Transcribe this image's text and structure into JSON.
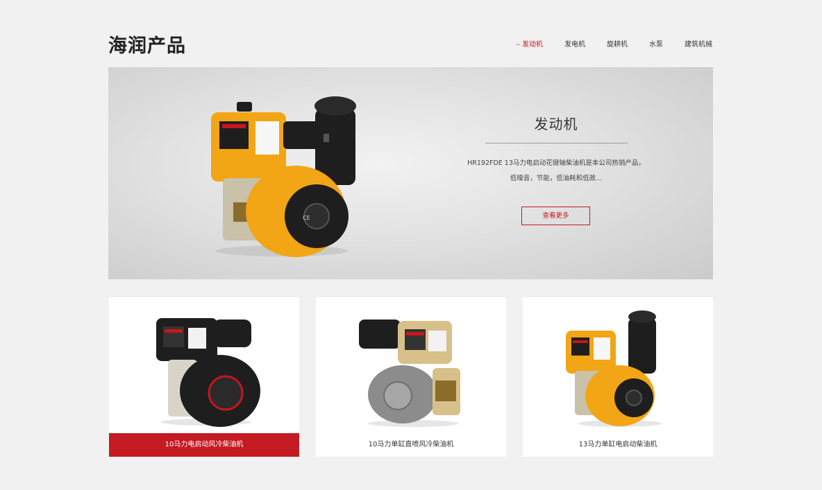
{
  "header": {
    "title": "海润产品",
    "nav": [
      {
        "label": "– 发动机",
        "active": true
      },
      {
        "label": "发电机",
        "active": false
      },
      {
        "label": "旋耕机",
        "active": false
      },
      {
        "label": "水泵",
        "active": false
      },
      {
        "label": "建筑机械",
        "active": false
      }
    ]
  },
  "hero": {
    "title": "发动机",
    "desc_line1": "HR192FDE 13马力电启动花键轴柴油机是本公司热销产品，",
    "desc_line2": "低噪音，节能，低油耗和低故...",
    "button_label": "查看更多",
    "image_icon": "diesel-engine-yellow"
  },
  "products": [
    {
      "caption": "10马力电启动风冷柴油机",
      "image_icon": "diesel-engine-black",
      "highlighted": true
    },
    {
      "caption": "10马力单缸直喷风冷柴油机",
      "image_icon": "diesel-engine-gold",
      "highlighted": false
    },
    {
      "caption": "13马力单缸电启动柴油机",
      "image_icon": "diesel-engine-yellow",
      "highlighted": false
    }
  ],
  "colors": {
    "accent": "#c8161d",
    "background": "#f1f1f1",
    "engine_yellow": "#f2a515",
    "engine_black": "#1e1e1e",
    "engine_gold": "#d8c08a"
  }
}
